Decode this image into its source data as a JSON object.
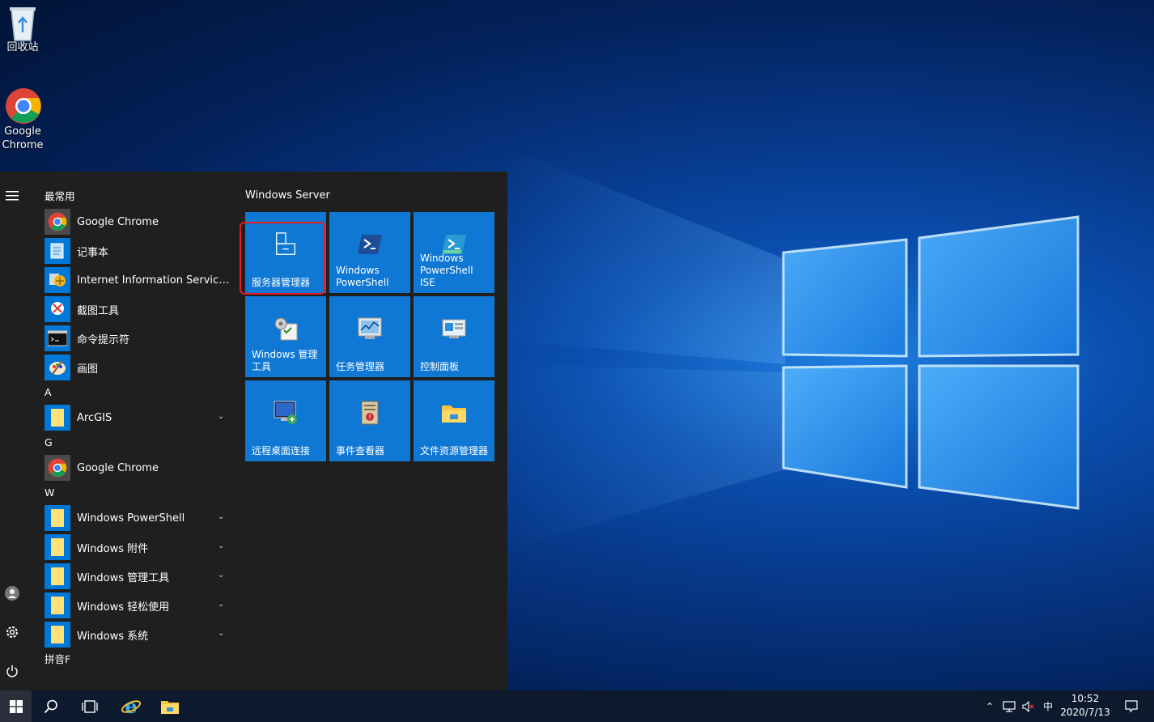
{
  "desktop": {
    "icons": [
      {
        "label": "回收站",
        "icon": "recycle-bin-icon"
      },
      {
        "label": "Google Chrome",
        "icon": "chrome-icon"
      }
    ]
  },
  "start_menu": {
    "rail": {
      "menu": "hamburger-icon",
      "user": "user-icon",
      "settings": "gear-icon",
      "power": "power-icon"
    },
    "groups": {
      "most_used": "最常用",
      "a": "A",
      "g": "G",
      "w": "W",
      "pinyin": "拼音F"
    },
    "most_used": [
      {
        "label": "Google Chrome",
        "icon": "chrome-icon"
      },
      {
        "label": "记事本",
        "icon": "notepad-icon"
      },
      {
        "label": "Internet Information Services (II...",
        "icon": "iis-icon"
      },
      {
        "label": "截图工具",
        "icon": "snipping-tool-icon"
      },
      {
        "label": "命令提示符",
        "icon": "cmd-icon"
      },
      {
        "label": "画图",
        "icon": "paint-icon"
      }
    ],
    "a_items": [
      {
        "label": "ArcGIS",
        "icon": "folder-icon"
      }
    ],
    "g_items": [
      {
        "label": "Google Chrome",
        "icon": "chrome-icon"
      }
    ],
    "w_items": [
      {
        "label": "Windows PowerShell",
        "icon": "folder-icon"
      },
      {
        "label": "Windows 附件",
        "icon": "folder-icon"
      },
      {
        "label": "Windows 管理工具",
        "icon": "folder-icon"
      },
      {
        "label": "Windows 轻松使用",
        "icon": "folder-icon"
      },
      {
        "label": "Windows 系统",
        "icon": "folder-icon"
      }
    ],
    "tiles_title": "Windows Server",
    "tiles": [
      {
        "line1": "服务器管理器",
        "line2": "",
        "icon": "server-manager-icon"
      },
      {
        "line1": "Windows",
        "line2": "PowerShell",
        "icon": "powershell-icon"
      },
      {
        "line1": "Windows",
        "line2": "PowerShell ISE",
        "icon": "powershell-ise-icon"
      },
      {
        "line1": "Windows 管理",
        "line2": "工具",
        "icon": "admin-tools-icon"
      },
      {
        "line1": "任务管理器",
        "line2": "",
        "icon": "task-manager-icon"
      },
      {
        "line1": "控制面板",
        "line2": "",
        "icon": "control-panel-icon"
      },
      {
        "line1": "远程桌面连接",
        "line2": "",
        "icon": "remote-desktop-icon"
      },
      {
        "line1": "事件查看器",
        "line2": "",
        "icon": "event-viewer-icon"
      },
      {
        "line1": "文件资源管理器",
        "line2": "",
        "icon": "file-explorer-icon"
      }
    ]
  },
  "taskbar": {
    "ime": "中",
    "time": "10:52",
    "date": "2020/7/13"
  },
  "colors": {
    "tile_blue": "#0f78d4",
    "start_bg": "#1f1f1f",
    "highlight_red": "#e81b23",
    "taskbar": "#0d1a2e"
  }
}
